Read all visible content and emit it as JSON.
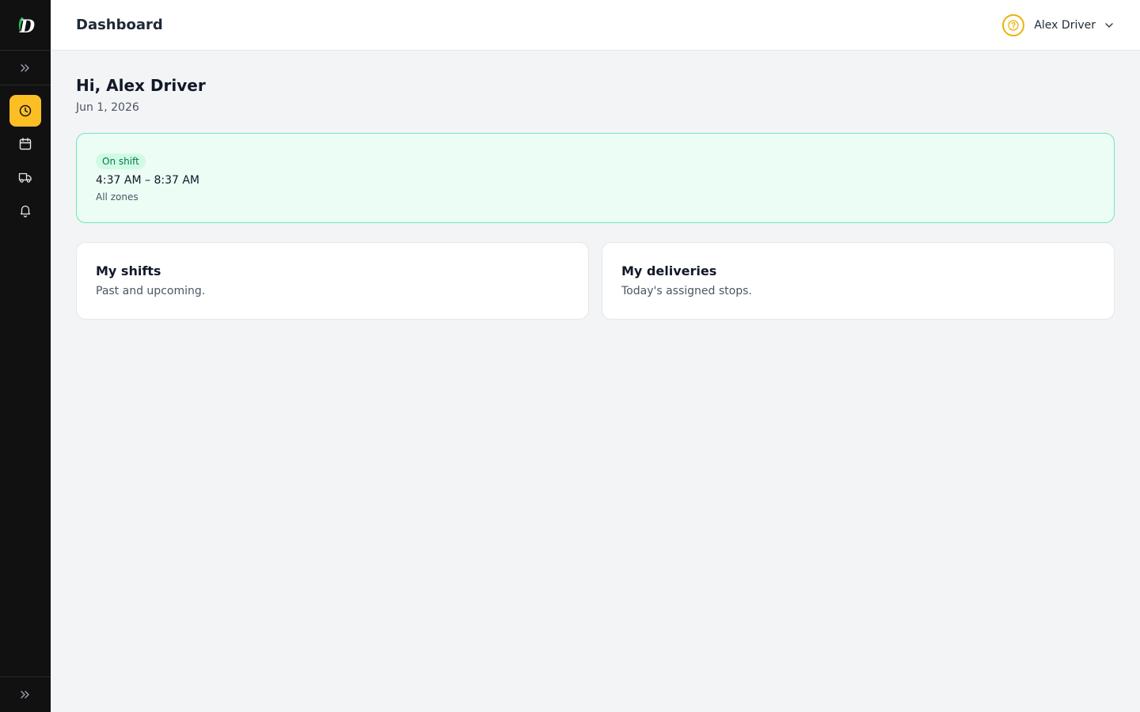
{
  "app": {
    "logo_letter": "D"
  },
  "sidebar": {
    "expand_icon": "chevrons-right-icon",
    "items": [
      {
        "name": "clock",
        "icon": "clock-icon",
        "active": true
      },
      {
        "name": "calendar",
        "icon": "calendar-icon",
        "active": false
      },
      {
        "name": "truck",
        "icon": "truck-icon",
        "active": false
      },
      {
        "name": "bell",
        "icon": "bell-icon",
        "active": false
      }
    ],
    "collapse_icon": "chevrons-right-icon"
  },
  "header": {
    "title": "Dashboard",
    "user_name": "Alex Driver"
  },
  "main": {
    "greeting": "Hi, Alex Driver",
    "date": "Jun 1, 2026",
    "shift": {
      "status": "On shift",
      "time": "4:37 AM – 8:37 AM",
      "zone": "All zones"
    },
    "cards": [
      {
        "title": "My shifts",
        "description": "Past and upcoming."
      },
      {
        "title": "My deliveries",
        "description": "Today's assigned stops."
      }
    ]
  },
  "colors": {
    "accent": "#fbbf24",
    "sidebar_bg": "#111111",
    "shift_bg": "#ecfdf5",
    "shift_border": "#6ee7b7"
  }
}
